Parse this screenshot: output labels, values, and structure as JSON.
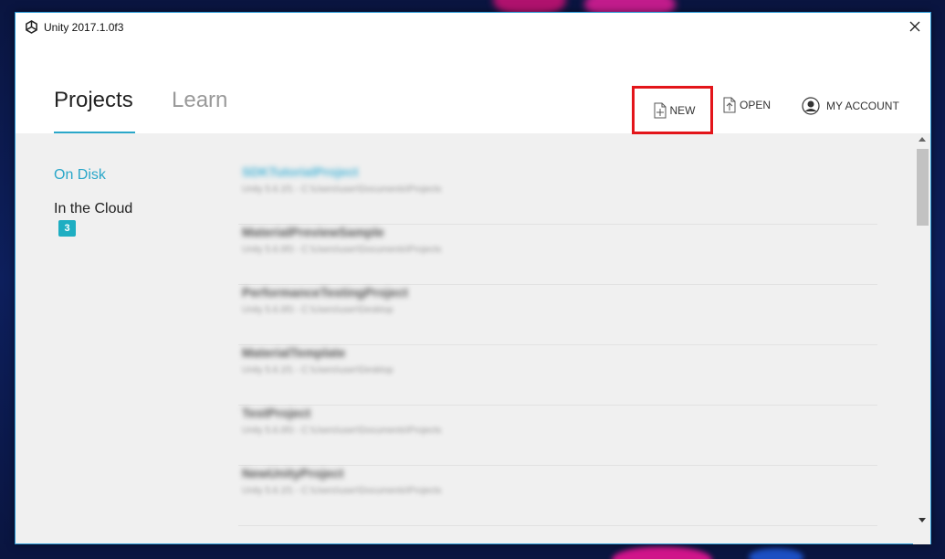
{
  "window": {
    "title": "Unity 2017.1.0f3"
  },
  "tabs": [
    {
      "label": "Projects",
      "active": true
    },
    {
      "label": "Learn",
      "active": false
    }
  ],
  "header_actions": {
    "new_label": "NEW",
    "open_label": "OPEN",
    "account_label": "MY ACCOUNT"
  },
  "sidebar": {
    "on_disk_label": "On Disk",
    "in_cloud_label": "In the Cloud",
    "cloud_count": "3"
  },
  "projects": [
    {
      "name": "SDKTutorialProject",
      "path": "Unity 5.6.1f1 - C:\\Users\\user\\Documents\\Projects"
    },
    {
      "name": "MaterialPreviewSample",
      "path": "Unity 5.6.0f3 - C:\\Users\\user\\Documents\\Projects"
    },
    {
      "name": "PerformanceTestingProject",
      "path": "Unity 5.6.0f3 - C:\\Users\\user\\Desktop"
    },
    {
      "name": "MaterialTemplate",
      "path": "Unity 5.6.1f1 - C:\\Users\\user\\Desktop"
    },
    {
      "name": "TestProject",
      "path": "Unity 5.6.0f3 - C:\\Users\\user\\Documents\\Projects"
    },
    {
      "name": "NewUnityProject",
      "path": "Unity 5.6.1f1 - C:\\Users\\user\\Documents\\Projects"
    }
  ],
  "colors": {
    "accent": "#2aa7c9",
    "highlight_border": "#e3151a",
    "badge": "#1eaec2"
  }
}
